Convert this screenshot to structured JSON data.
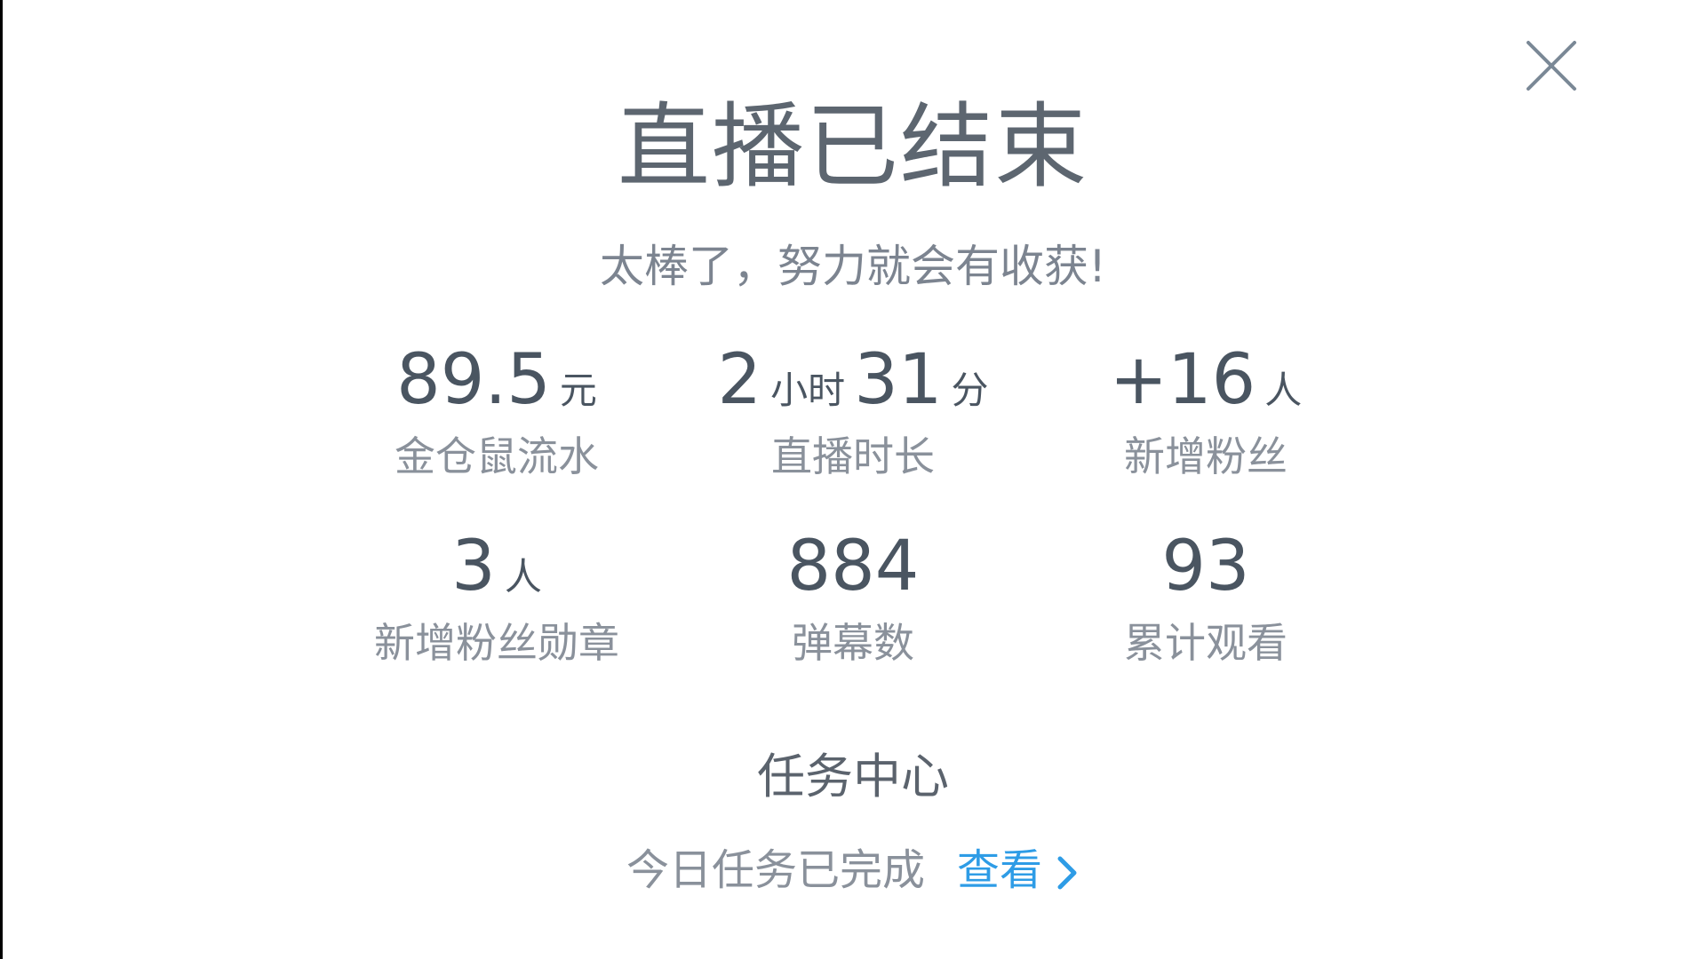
{
  "dialog": {
    "title": "直播已结束",
    "subtitle": "太棒了，努力就会有收获!",
    "close_icon": "close-icon"
  },
  "stats": {
    "revenue": {
      "value": "89.5",
      "unit": "元",
      "label": "金仓鼠流水"
    },
    "duration": {
      "hours": "2",
      "hours_unit": "小时",
      "minutes": "31",
      "minutes_unit": "分",
      "label": "直播时长"
    },
    "new_fans": {
      "value": "+16",
      "unit": "人",
      "label": "新增粉丝"
    },
    "fan_badges": {
      "value": "3",
      "unit": "人",
      "label": "新增粉丝勋章"
    },
    "danmaku": {
      "value": "884",
      "label": "弹幕数"
    },
    "total_views": {
      "value": "93",
      "label": "累计观看"
    }
  },
  "task_center": {
    "title": "任务中心",
    "status": "今日任务已完成",
    "link_label": "查看",
    "link_icon": "chevron-right-icon"
  },
  "colors": {
    "text_primary": "#5d6670",
    "text_secondary": "#8a919b",
    "value_text": "#4a5561",
    "link": "#2e9ce6",
    "close_icon": "#7a8896"
  }
}
